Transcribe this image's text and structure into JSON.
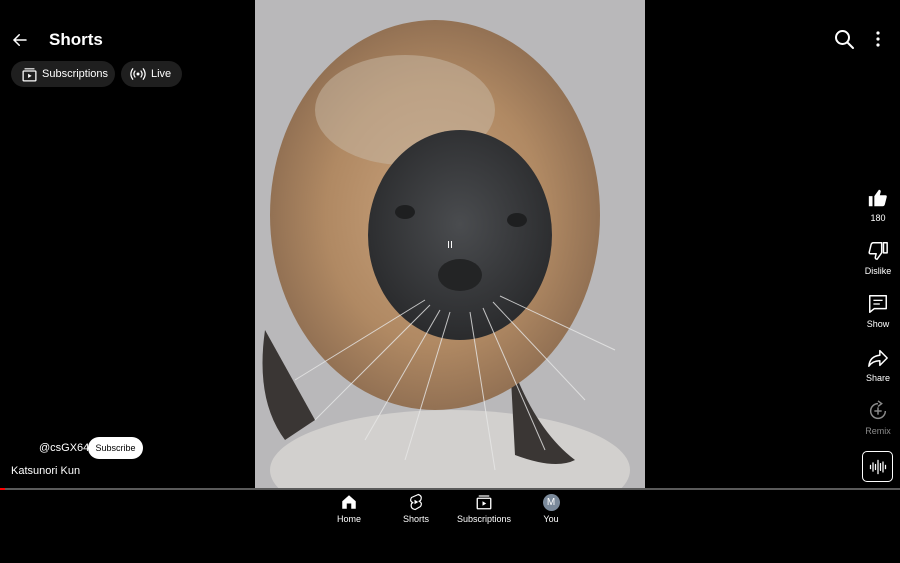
{
  "header": {
    "title": "Shorts",
    "back_icon": "arrow-left-icon",
    "search_icon": "search-icon",
    "more_icon": "more-vert-icon"
  },
  "chips": [
    {
      "label": "Subscriptions",
      "icon": "subscriptions-icon"
    },
    {
      "label": "Live",
      "icon": "live-broadcast-icon"
    }
  ],
  "actions": {
    "like": {
      "label": "180",
      "icon": "thumbs-up-icon"
    },
    "dislike": {
      "label": "Dislike",
      "icon": "thumbs-down-icon"
    },
    "comments": {
      "label": "Show",
      "icon": "comment-icon"
    },
    "share": {
      "label": "Share",
      "icon": "share-icon"
    },
    "remix": {
      "label": "Remix",
      "icon": "remix-icon"
    },
    "sound": {
      "icon": "sound-wave-icon"
    }
  },
  "video": {
    "state_indicator": "II",
    "progress_fraction": 0.005
  },
  "channel": {
    "handle": "@csGX64",
    "subscribe_label": "Subscribe",
    "caption": "Katsunori Kun"
  },
  "bottom_nav": [
    {
      "label": "Home",
      "icon": "home-icon"
    },
    {
      "label": "Shorts",
      "icon": "shorts-icon"
    },
    {
      "label": "Subscriptions",
      "icon": "subscriptions-icon"
    },
    {
      "label": "You",
      "avatar_letter": "M"
    }
  ],
  "colors": {
    "background": "#000000",
    "progress_accent": "#ff0000",
    "chip_bg": "#1f1f1f"
  }
}
